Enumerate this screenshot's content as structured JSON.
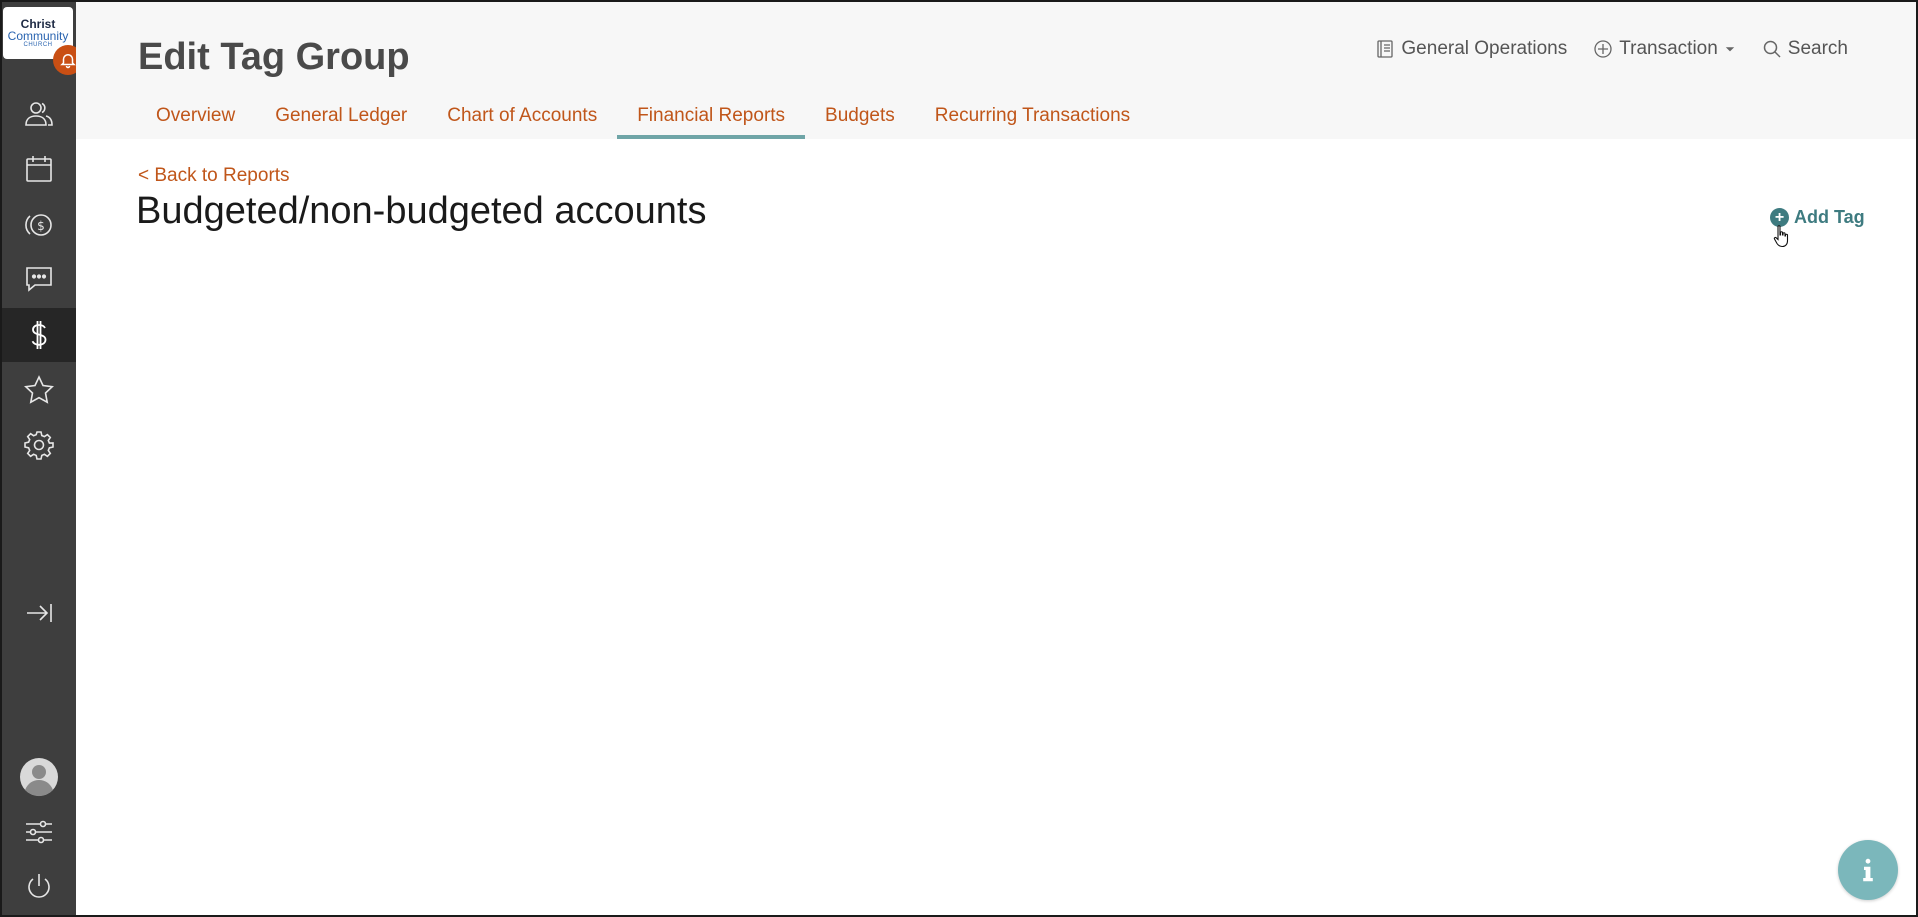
{
  "logo": {
    "line1": "Christ",
    "line2": "Community",
    "line3": "CHURCH"
  },
  "header": {
    "title": "Edit Tag Group",
    "actions": [
      {
        "label": "General Operations",
        "icon": "ledger-icon"
      },
      {
        "label": "Transaction",
        "icon": "plus-circle-icon",
        "dropdown": true
      },
      {
        "label": "Search",
        "icon": "search-icon"
      }
    ]
  },
  "tabs": [
    {
      "label": "Overview",
      "active": false
    },
    {
      "label": "General Ledger",
      "active": false
    },
    {
      "label": "Chart of Accounts",
      "active": false
    },
    {
      "label": "Financial Reports",
      "active": true
    },
    {
      "label": "Budgets",
      "active": false
    },
    {
      "label": "Recurring Transactions",
      "active": false
    }
  ],
  "main": {
    "back_label": "< Back to Reports",
    "report_title": "Budgeted/non-budgeted accounts",
    "add_tag_label": "Add Tag"
  },
  "sidebar": {
    "items": [
      {
        "icon": "people-icon",
        "active": false
      },
      {
        "icon": "calendar-icon",
        "active": false
      },
      {
        "icon": "giving-icon",
        "active": false
      },
      {
        "icon": "messages-icon",
        "active": false
      },
      {
        "icon": "finance-dollar-icon",
        "active": true
      },
      {
        "icon": "star-icon",
        "active": false
      },
      {
        "icon": "gear-icon",
        "active": false
      },
      {
        "icon": "collapse-arrow-icon",
        "active": false
      },
      {
        "icon": "avatar",
        "active": false
      },
      {
        "icon": "sliders-icon",
        "active": false
      },
      {
        "icon": "power-icon",
        "active": false
      }
    ]
  },
  "colors": {
    "sidebar_bg": "#3e3e3e",
    "sidebar_active": "#262626",
    "accent_orange": "#c0561a",
    "accent_teal": "#3e7b80",
    "tab_underline": "#6fa5a7",
    "notification": "#c94f14",
    "info_button": "#7bb7bb"
  }
}
